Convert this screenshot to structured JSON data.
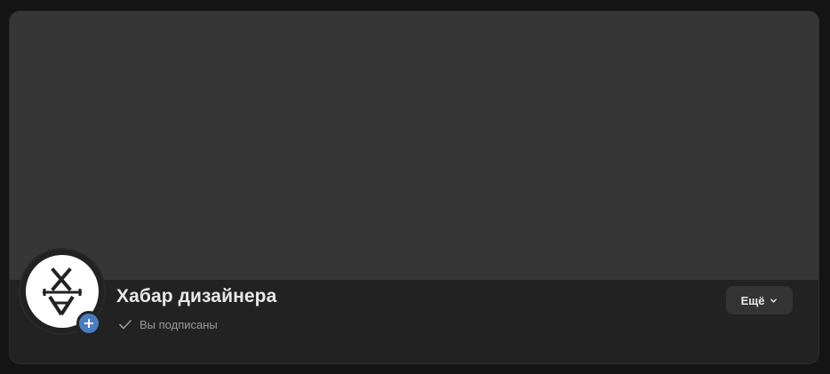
{
  "community": {
    "name": "Хабар дизайнера",
    "subscription_status": "Вы подписаны"
  },
  "actions": {
    "more_label": "Ещё"
  },
  "icons": {
    "avatar": "xa-monogram-logo",
    "badge": "plus-icon",
    "status": "check-icon",
    "dropdown": "chevron-down-icon"
  },
  "colors": {
    "page_background": "#141414",
    "cover": "#363636",
    "card": "#222222",
    "accent_badge": "#4a7cc0",
    "button": "#333333"
  }
}
